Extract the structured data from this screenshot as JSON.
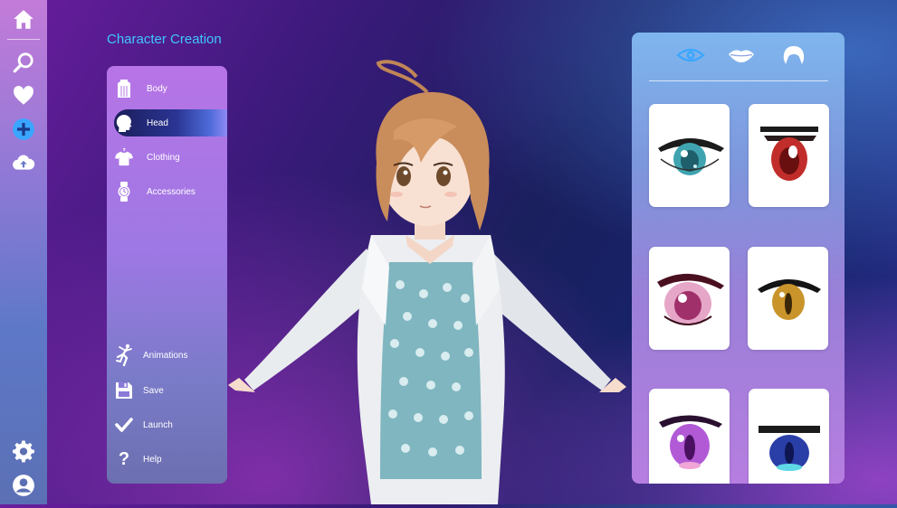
{
  "app": {
    "title": "Character Creation"
  },
  "rail": [
    {
      "name": "home-icon"
    },
    {
      "name": "search-icon"
    },
    {
      "name": "heart-icon"
    },
    {
      "name": "add-icon"
    },
    {
      "name": "cloud-upload-icon"
    },
    {
      "name": "gear-icon"
    },
    {
      "name": "user-icon"
    }
  ],
  "categories": {
    "items": [
      {
        "label": "Body",
        "icon": "shirt-body-icon"
      },
      {
        "label": "Head",
        "icon": "head-icon",
        "active": true
      },
      {
        "label": "Clothing",
        "icon": "tshirt-icon"
      },
      {
        "label": "Accessories",
        "icon": "watch-icon"
      }
    ],
    "actions": [
      {
        "label": "Animations",
        "icon": "dance-icon"
      },
      {
        "label": "Save",
        "icon": "floppy-icon"
      },
      {
        "label": "Launch",
        "icon": "check-icon"
      },
      {
        "label": "Help",
        "icon": "question-icon"
      }
    ]
  },
  "selector": {
    "tabs": [
      {
        "icon": "eye-icon",
        "active": true
      },
      {
        "icon": "lips-icon"
      },
      {
        "icon": "hair-icon"
      }
    ],
    "options": [
      {
        "icon": "eye-option-teal"
      },
      {
        "icon": "eye-option-red"
      },
      {
        "icon": "eye-option-pink"
      },
      {
        "icon": "eye-option-amber"
      },
      {
        "icon": "eye-option-violet"
      },
      {
        "icon": "eye-option-blue"
      }
    ]
  },
  "colors": {
    "accent": "#3fc7ff",
    "active_tab": "#3aa6ff"
  }
}
